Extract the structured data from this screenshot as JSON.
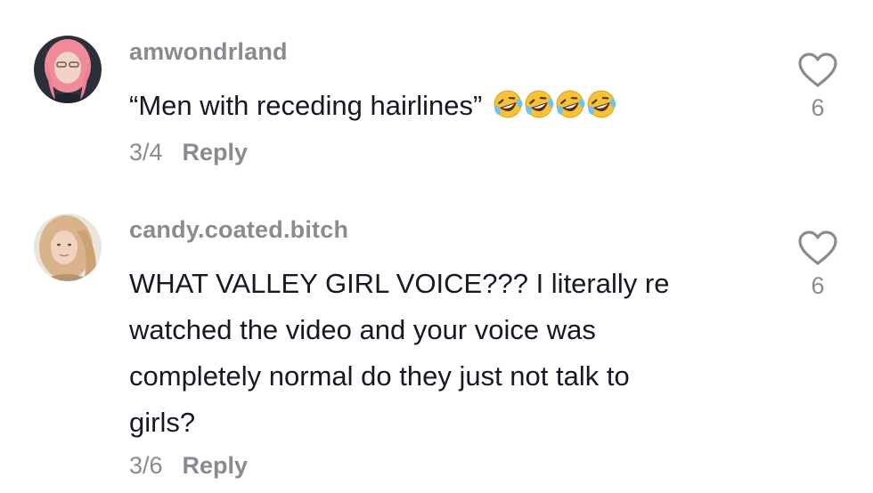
{
  "comments": [
    {
      "username": "amwondrland",
      "text": "“Men with receding hairlines”",
      "emojis": [
        "rolling-on-floor-laughing-emoji",
        "rolling-on-floor-laughing-emoji",
        "rolling-on-floor-laughing-emoji",
        "rolling-on-floor-laughing-emoji"
      ],
      "date": "3/4",
      "reply_label": "Reply",
      "likes": "6",
      "like_icon": "heart-outline-icon",
      "avatar_hair_color": "#f08a9b"
    },
    {
      "username": "candy.coated.bitch",
      "text_lines": [
        "WHAT VALLEY GIRL VOICE??? I literally re",
        "watched the video and your voice was",
        "completely normal do they just not talk to",
        "girls?"
      ],
      "date": "3/6",
      "reply_label": "Reply",
      "likes": "6",
      "like_icon": "heart-outline-icon",
      "avatar_hair_color": "#d9b48a"
    }
  ],
  "colors": {
    "primary_text": "#161823",
    "secondary_text": "#8a8b91",
    "background": "#ffffff"
  }
}
